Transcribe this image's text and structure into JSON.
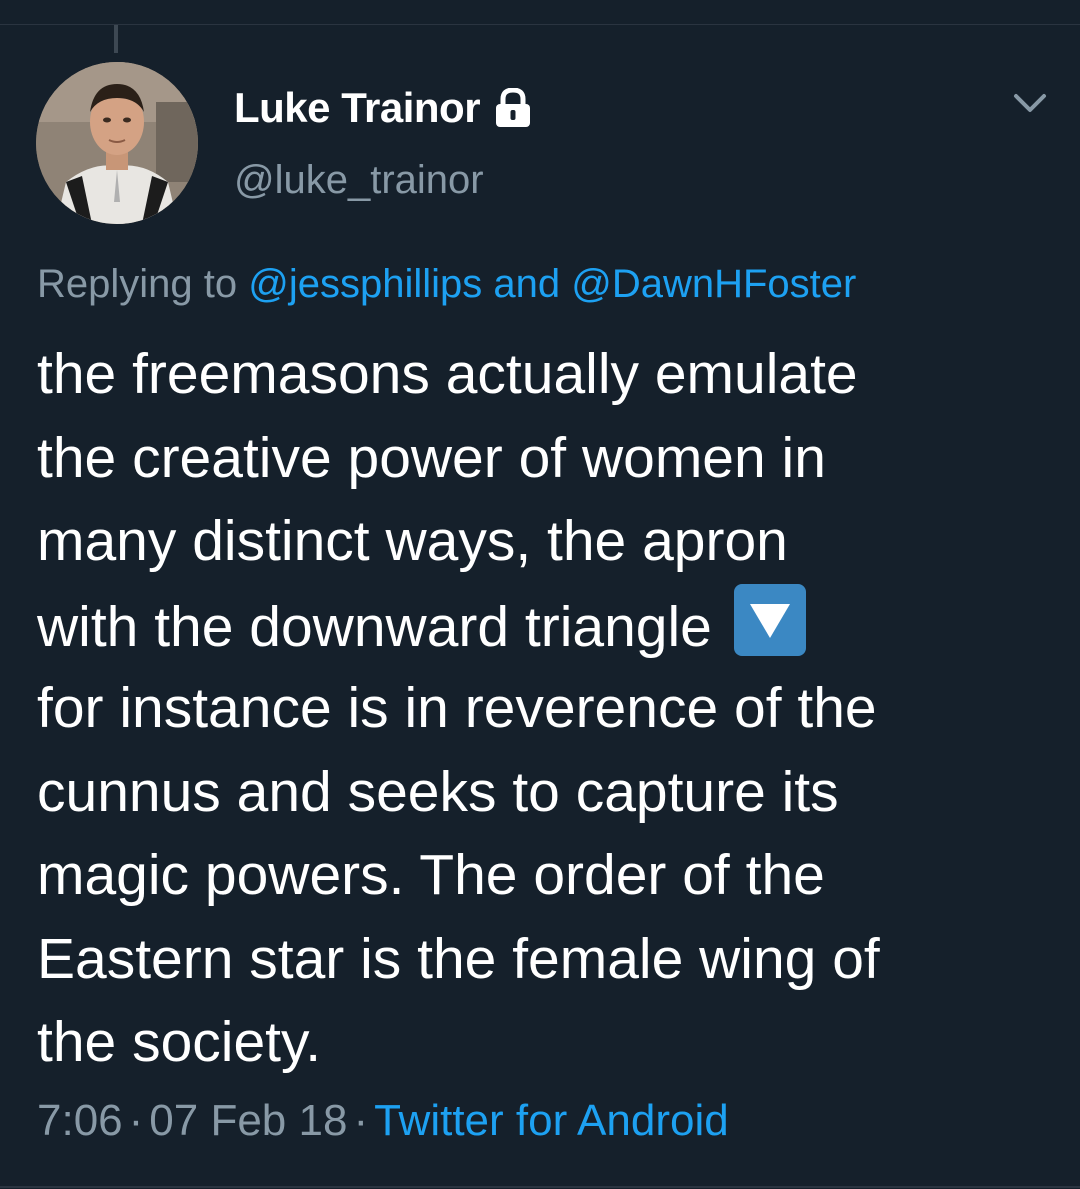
{
  "tweet": {
    "author": {
      "display_name": "Luke Trainor",
      "handle": "@luke_trainor",
      "protected_icon": "lock-icon"
    },
    "replying": {
      "prefix": "Replying to ",
      "mention1": "@jessphillips",
      "connector": " and ",
      "mention2": "@DawnHFoster"
    },
    "text_lines": [
      "the freemasons actually emulate",
      "the creative power of women in",
      "many distinct ways, the apron",
      "with the downward triangle ",
      "for instance is in reverence of the",
      "cunnus and seeks to capture its",
      "magic powers. The order of the",
      "Eastern star is the female wing of",
      "the society."
    ],
    "emoji": "down-triangle-button-emoji",
    "meta": {
      "time": "7:06",
      "separator": "·",
      "date": "07 Feb 18",
      "source": "Twitter for Android"
    },
    "menu_icon": "chevron-down-icon"
  },
  "colors": {
    "background": "#15202b",
    "text": "#ffffff",
    "secondary": "#8899a6",
    "link": "#1da1f2",
    "emoji_bg": "#3b88c3"
  }
}
